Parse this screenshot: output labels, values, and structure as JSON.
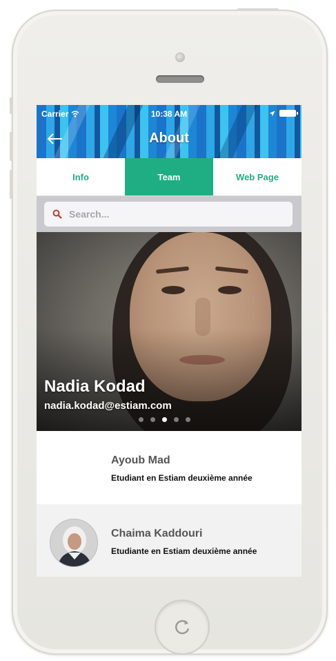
{
  "status_bar": {
    "carrier": "Carrier",
    "time": "10:38 AM"
  },
  "header": {
    "title": "About",
    "back_icon": "arrow-left-icon"
  },
  "tabs": [
    {
      "label": "Info",
      "active": false
    },
    {
      "label": "Team",
      "active": true
    },
    {
      "label": "Web Page",
      "active": false
    }
  ],
  "search": {
    "placeholder": "Search...",
    "icon": "search-icon"
  },
  "featured": {
    "name": "Nadia Kodad",
    "email": "nadia.kodad@estiam.com",
    "page_count": 5,
    "current_page": 3
  },
  "team": [
    {
      "name": "Ayoub Mad",
      "description": "Etudiant en Estiam deuxième année"
    },
    {
      "name": "Chaima Kaddouri",
      "description": "Etudiante en Estiam deuxième année"
    }
  ],
  "colors": {
    "accent": "#1fae84",
    "header_blue": "#1b74c9",
    "search_bg": "#c9c9ce",
    "device_shell": "#efeeea"
  }
}
